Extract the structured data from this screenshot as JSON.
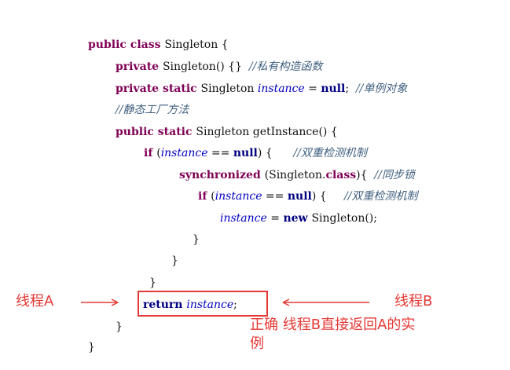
{
  "code": {
    "lines": [
      {
        "parts": [
          {
            "t": "public class ",
            "c": "kw"
          },
          {
            "t": "Singleton {",
            "c": ""
          }
        ]
      },
      {
        "parts": [
          {
            "t": "private ",
            "c": "kw"
          },
          {
            "t": "Singleton() {}  ",
            "c": ""
          },
          {
            "t": "//私有构造函数",
            "c": "cm"
          }
        ]
      },
      {
        "parts": [
          {
            "t": "private static ",
            "c": "kw"
          },
          {
            "t": "Singleton ",
            "c": ""
          },
          {
            "t": "instance",
            "c": "it"
          },
          {
            "t": " = ",
            "c": ""
          },
          {
            "t": "null",
            "c": "kb"
          },
          {
            "t": ";  ",
            "c": ""
          },
          {
            "t": "//单例对象",
            "c": "cm"
          }
        ]
      },
      {
        "parts": [
          {
            "t": "//静态工厂方法",
            "c": "cm"
          }
        ]
      },
      {
        "parts": [
          {
            "t": "public static ",
            "c": "kw"
          },
          {
            "t": "Singleton getInstance() {",
            "c": ""
          }
        ]
      },
      {
        "parts": [
          {
            "t": "if ",
            "c": "kw"
          },
          {
            "t": "(",
            "c": ""
          },
          {
            "t": "instance",
            "c": "it"
          },
          {
            "t": " == ",
            "c": ""
          },
          {
            "t": "null",
            "c": "kb"
          },
          {
            "t": ") {      ",
            "c": ""
          },
          {
            "t": "//双重检测机制",
            "c": "cm"
          }
        ]
      },
      {
        "parts": [
          {
            "t": "synchronized ",
            "c": "kw"
          },
          {
            "t": "(Singleton.",
            "c": ""
          },
          {
            "t": "class",
            "c": "kw"
          },
          {
            "t": "){  ",
            "c": ""
          },
          {
            "t": "//同步锁",
            "c": "cm"
          }
        ]
      },
      {
        "parts": [
          {
            "t": "if ",
            "c": "kw"
          },
          {
            "t": "(",
            "c": ""
          },
          {
            "t": "instance",
            "c": "it"
          },
          {
            "t": " == ",
            "c": ""
          },
          {
            "t": "null",
            "c": "kb"
          },
          {
            "t": ") {     ",
            "c": ""
          },
          {
            "t": "//双重检测机制",
            "c": "cm"
          }
        ]
      },
      {
        "parts": [
          {
            "t": "instance",
            "c": "it"
          },
          {
            "t": " = ",
            "c": ""
          },
          {
            "t": "new ",
            "c": "kb"
          },
          {
            "t": "Singleton();",
            "c": ""
          }
        ]
      },
      {
        "parts": [
          {
            "t": "}",
            "c": ""
          }
        ]
      },
      {
        "parts": [
          {
            "t": "}",
            "c": ""
          }
        ]
      },
      {
        "parts": [
          {
            "t": "}",
            "c": ""
          }
        ]
      },
      {
        "parts": [
          {
            "t": "return ",
            "c": "kb"
          },
          {
            "t": "instance",
            "c": "it"
          },
          {
            "t": ";",
            "c": ""
          }
        ]
      },
      {
        "parts": [
          {
            "t": "}",
            "c": ""
          }
        ]
      },
      {
        "parts": [
          {
            "t": "}",
            "c": ""
          }
        ]
      }
    ]
  },
  "annotations": {
    "thread_a": "线程A",
    "thread_b": "线程B",
    "note": "正确 线程B直接返回A的实\n例"
  },
  "colors": {
    "annotation": "#e53935"
  }
}
